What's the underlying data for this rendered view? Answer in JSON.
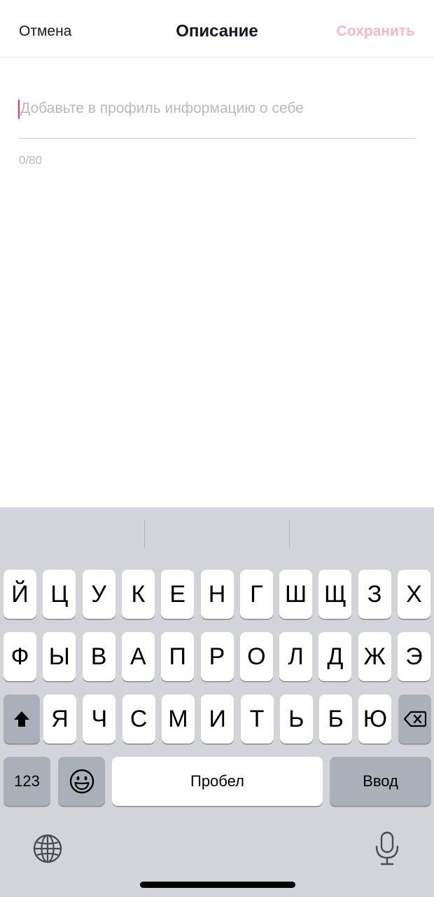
{
  "header": {
    "cancel_label": "Отмена",
    "title": "Описание",
    "save_label": "Сохранить"
  },
  "bio": {
    "placeholder": "Добавьте в профиль информацию о себе",
    "value": "",
    "counter": "0/80"
  },
  "keyboard": {
    "row1": [
      "Й",
      "Ц",
      "У",
      "К",
      "Е",
      "Н",
      "Г",
      "Ш",
      "Щ",
      "З",
      "Х"
    ],
    "row2": [
      "Ф",
      "Ы",
      "В",
      "А",
      "П",
      "Р",
      "О",
      "Л",
      "Д",
      "Ж",
      "Э"
    ],
    "row3": [
      "Я",
      "Ч",
      "С",
      "М",
      "И",
      "Т",
      "Ь",
      "Б",
      "Ю"
    ],
    "numbers_label": "123",
    "space_label": "Пробел",
    "return_label": "Ввод",
    "icons": {
      "shift": "shift-icon",
      "backspace": "backspace-icon",
      "emoji": "emoji-icon",
      "globe": "globe-icon",
      "mic": "microphone-icon"
    }
  },
  "colors": {
    "accent": "#fe2c55",
    "save_disabled": "#f8b7c6",
    "text_primary": "#161823",
    "placeholder": "#b8b9bd",
    "keyboard_bg": "#d2d4da"
  }
}
